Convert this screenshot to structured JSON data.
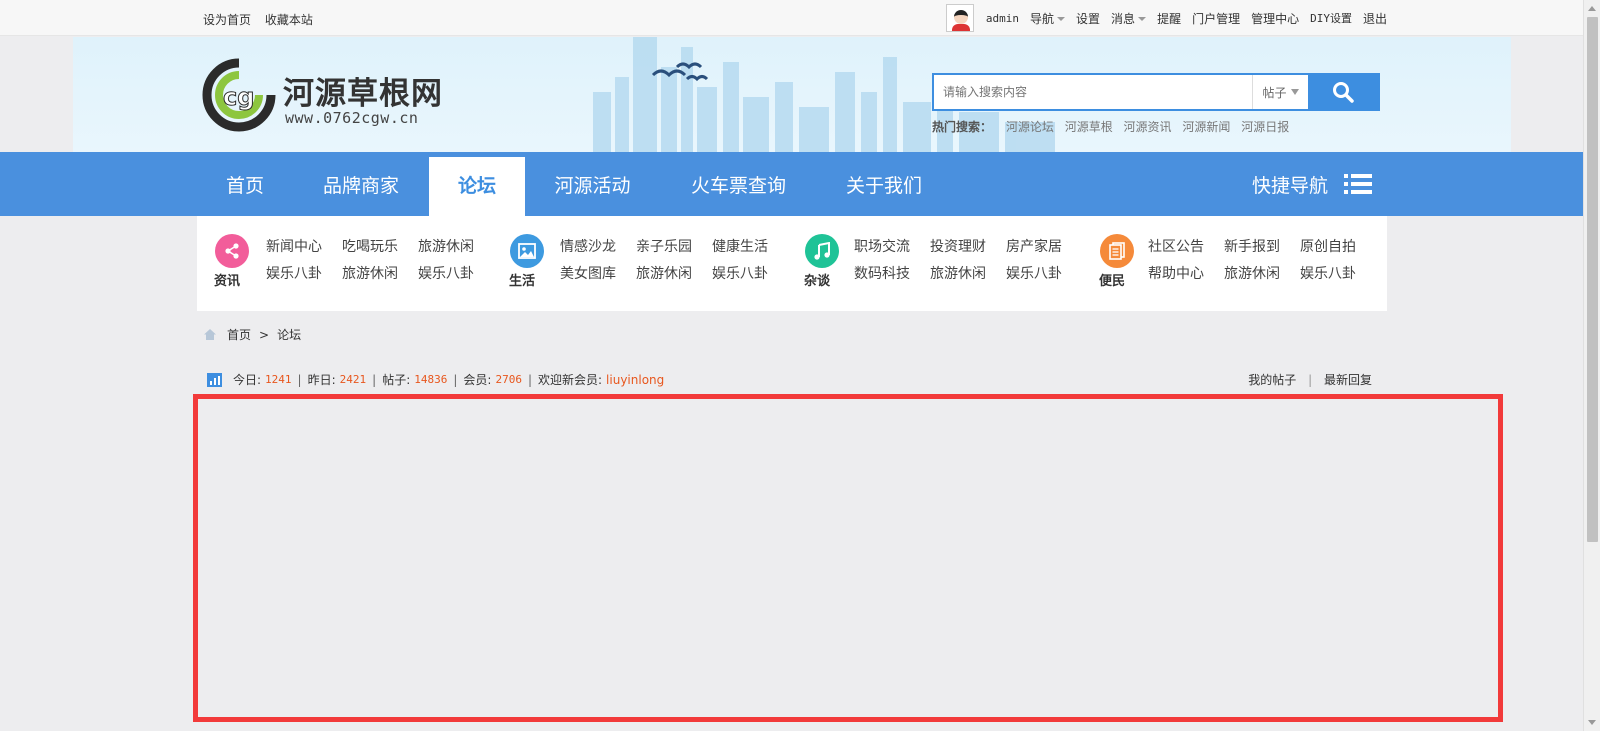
{
  "topbar": {
    "set_home": "设为首页",
    "bookmark": "收藏本站",
    "username": "admin",
    "nav_menu": "导航",
    "settings": "设置",
    "messages": "消息",
    "reminders": "提醒",
    "portal_admin": "门户管理",
    "admin_center": "管理中心",
    "diy_settings": "DIY设置",
    "logout": "退出"
  },
  "header": {
    "logo_text": "河源草根网",
    "logo_url": "www.0762cgw.cn",
    "search_placeholder": "请输入搜索内容",
    "search_type": "帖子",
    "hot_label": "热门搜索：",
    "hot_keywords": [
      "河源论坛",
      "河源草根",
      "河源资讯",
      "河源新闻",
      "河源日报"
    ]
  },
  "nav": {
    "items": [
      "首页",
      "品牌商家",
      "论坛",
      "河源活动",
      "火车票查询",
      "关于我们"
    ],
    "active_index": 2,
    "quick_nav": "快捷导航"
  },
  "categories": [
    {
      "name": "资讯",
      "icon": "share-icon",
      "color": "#f25d9a",
      "links": [
        "新闻中心",
        "吃喝玩乐",
        "旅游休闲",
        "娱乐八卦",
        "旅游休闲",
        "娱乐八卦"
      ]
    },
    {
      "name": "生活",
      "icon": "image-icon",
      "color": "#3d9ae0",
      "links": [
        "情感沙龙",
        "亲子乐园",
        "健康生活",
        "美女图库",
        "旅游休闲",
        "娱乐八卦"
      ]
    },
    {
      "name": "杂谈",
      "icon": "music-icon",
      "color": "#1fc397",
      "links": [
        "职场交流",
        "投资理财",
        "房产家居",
        "数码科技",
        "旅游休闲",
        "娱乐八卦"
      ]
    },
    {
      "name": "便民",
      "icon": "document-icon",
      "color": "#f58a3a",
      "links": [
        "社区公告",
        "新手报到",
        "原创自拍",
        "帮助中心",
        "旅游休闲",
        "娱乐八卦"
      ]
    }
  ],
  "breadcrumb": {
    "home": "首页",
    "sep": ">",
    "current": "论坛"
  },
  "stats": {
    "today_label": "今日:",
    "today": "1241",
    "yesterday_label": "昨日:",
    "yesterday": "2421",
    "posts_label": "帖子:",
    "posts": "14836",
    "members_label": "会员:",
    "members": "2706",
    "welcome_label": "欢迎新会员:",
    "new_member": "liuyinlong",
    "my_posts": "我的帖子",
    "latest_replies": "最新回复"
  },
  "colors": {
    "brand_blue": "#4a90de",
    "highlight_red": "#f23a3a",
    "number_orange": "#e8571e"
  }
}
